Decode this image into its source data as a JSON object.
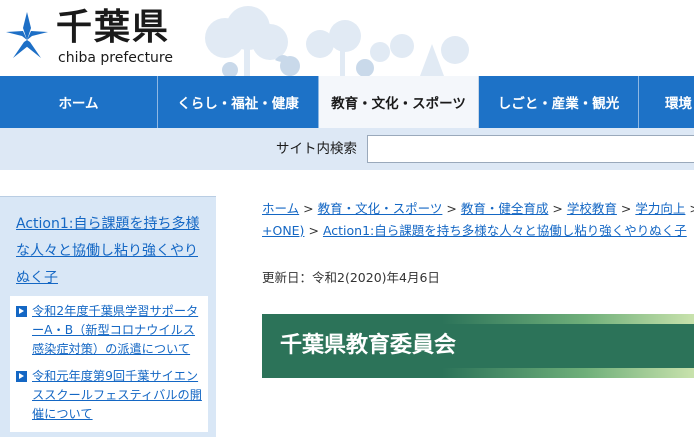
{
  "header": {
    "logo_title": "千葉県",
    "logo_sub": "chiba prefecture"
  },
  "nav": {
    "items": [
      {
        "label": "ホーム"
      },
      {
        "label": "くらし・福祉・健康"
      },
      {
        "label": "教育・文化・スポーツ",
        "active": true
      },
      {
        "label": "しごと・産業・観光"
      },
      {
        "label": "環境"
      }
    ]
  },
  "search": {
    "label": "サイト内検索",
    "value": ""
  },
  "sidebar": {
    "heading": "Action1:自ら課題を持ち多様な人々と協働し粘り強くやりぬく子",
    "links": [
      "令和2年度千葉県学習サポーターA・B（新型コロナウイルス感染症対策）の派遣について",
      "令和元年度第9回千葉サイエンススクールフェスティバルの開催について"
    ]
  },
  "breadcrumb": {
    "row1": [
      "ホーム",
      "教育・文化・スポーツ",
      "教育・健全育成",
      "学校教育",
      "学力向上"
    ],
    "row2_prefix": "+ONE)",
    "row2_link": "Action1:自ら課題を持ち多様な人々と協働し粘り強くやりぬく子",
    "separator": ">"
  },
  "updated": "更新日：令和2(2020)年4月6日",
  "main": {
    "title": "千葉県教育委員会"
  },
  "colors": {
    "nav_bg": "#1d72c7",
    "link": "#1467c4",
    "title_bg": "#2c7359",
    "sidebar_bg": "#d9e7f6"
  }
}
